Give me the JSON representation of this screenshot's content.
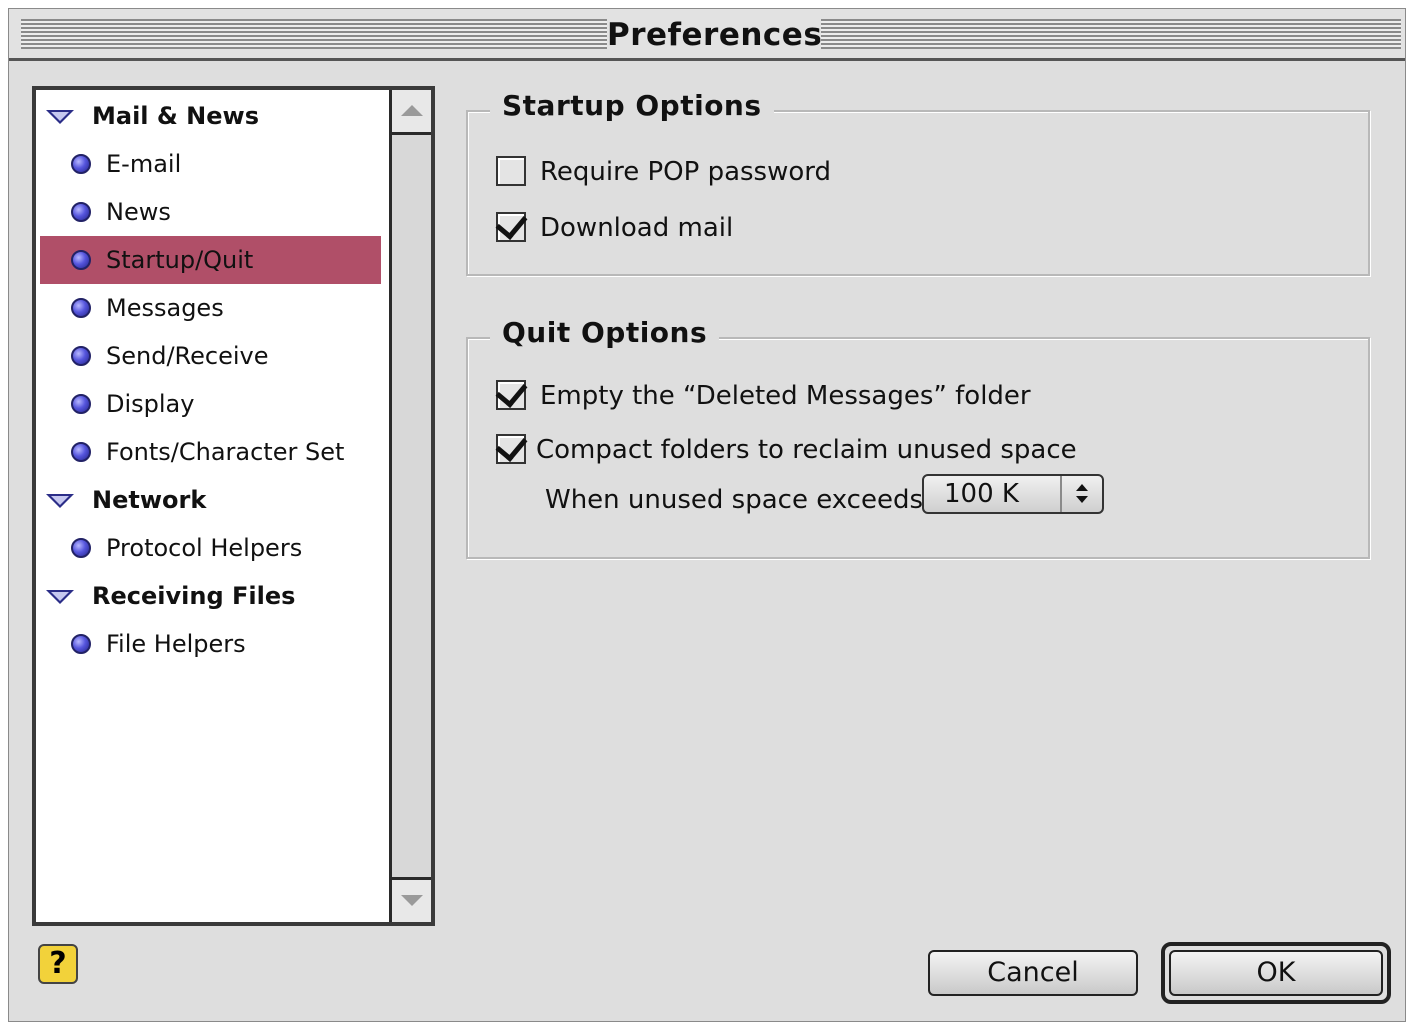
{
  "window": {
    "title": "Preferences"
  },
  "sidebar": {
    "items": [
      {
        "label": "Mail & News",
        "type": "category"
      },
      {
        "label": "E-mail",
        "type": "item"
      },
      {
        "label": "News",
        "type": "item"
      },
      {
        "label": "Startup/Quit",
        "type": "item",
        "selected": true
      },
      {
        "label": "Messages",
        "type": "item"
      },
      {
        "label": "Send/Receive",
        "type": "item"
      },
      {
        "label": "Display",
        "type": "item"
      },
      {
        "label": "Fonts/Character Set",
        "type": "item"
      },
      {
        "label": "Network",
        "type": "category"
      },
      {
        "label": "Protocol Helpers",
        "type": "item"
      },
      {
        "label": "Receiving Files",
        "type": "category"
      },
      {
        "label": "File Helpers",
        "type": "item"
      }
    ],
    "selected_color": "#b04f68"
  },
  "startup_options": {
    "title": "Startup Options",
    "require_pop_password": {
      "label": "Require POP password",
      "checked": false
    },
    "download_mail": {
      "label": "Download mail",
      "checked": true
    }
  },
  "quit_options": {
    "title": "Quit Options",
    "empty_deleted": {
      "label": "Empty the “Deleted Messages” folder",
      "checked": true
    },
    "compact_folders": {
      "label": "Compact folders to reclaim unused space",
      "checked": true
    },
    "threshold_label": "When unused space exceeds:",
    "threshold_value": "100 K"
  },
  "help": {
    "icon": "help-icon",
    "glyph": "?"
  },
  "buttons": {
    "cancel": "Cancel",
    "ok": "OK"
  }
}
